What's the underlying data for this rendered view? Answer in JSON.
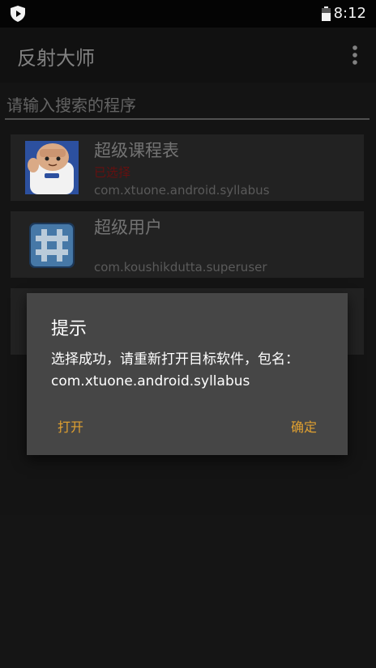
{
  "status_bar": {
    "time": "8:12",
    "left_icon": "shield-play-icon",
    "battery_icon": "battery-icon"
  },
  "app_bar": {
    "title": "反射大师",
    "menu_icon": "overflow-menu-icon"
  },
  "search": {
    "placeholder": "请输入搜索的程序",
    "value": ""
  },
  "apps": [
    {
      "name": "超级课程表",
      "badge": "已选择",
      "package": "com.xtuone.android.syllabus",
      "icon": "syllabus-app-icon"
    },
    {
      "name": "超级用户",
      "badge": "",
      "package": "com.koushikdutta.superuser",
      "icon": "superuser-app-icon"
    }
  ],
  "dialog": {
    "title": "提示",
    "message": "选择成功，请重新打开目标软件，包名：com.xtuone.android.syllabus",
    "negative_label": "打开",
    "positive_label": "确定"
  },
  "colors": {
    "accent": "#e0a030",
    "badge": "#6b1111",
    "dialog_bg": "#464646"
  }
}
